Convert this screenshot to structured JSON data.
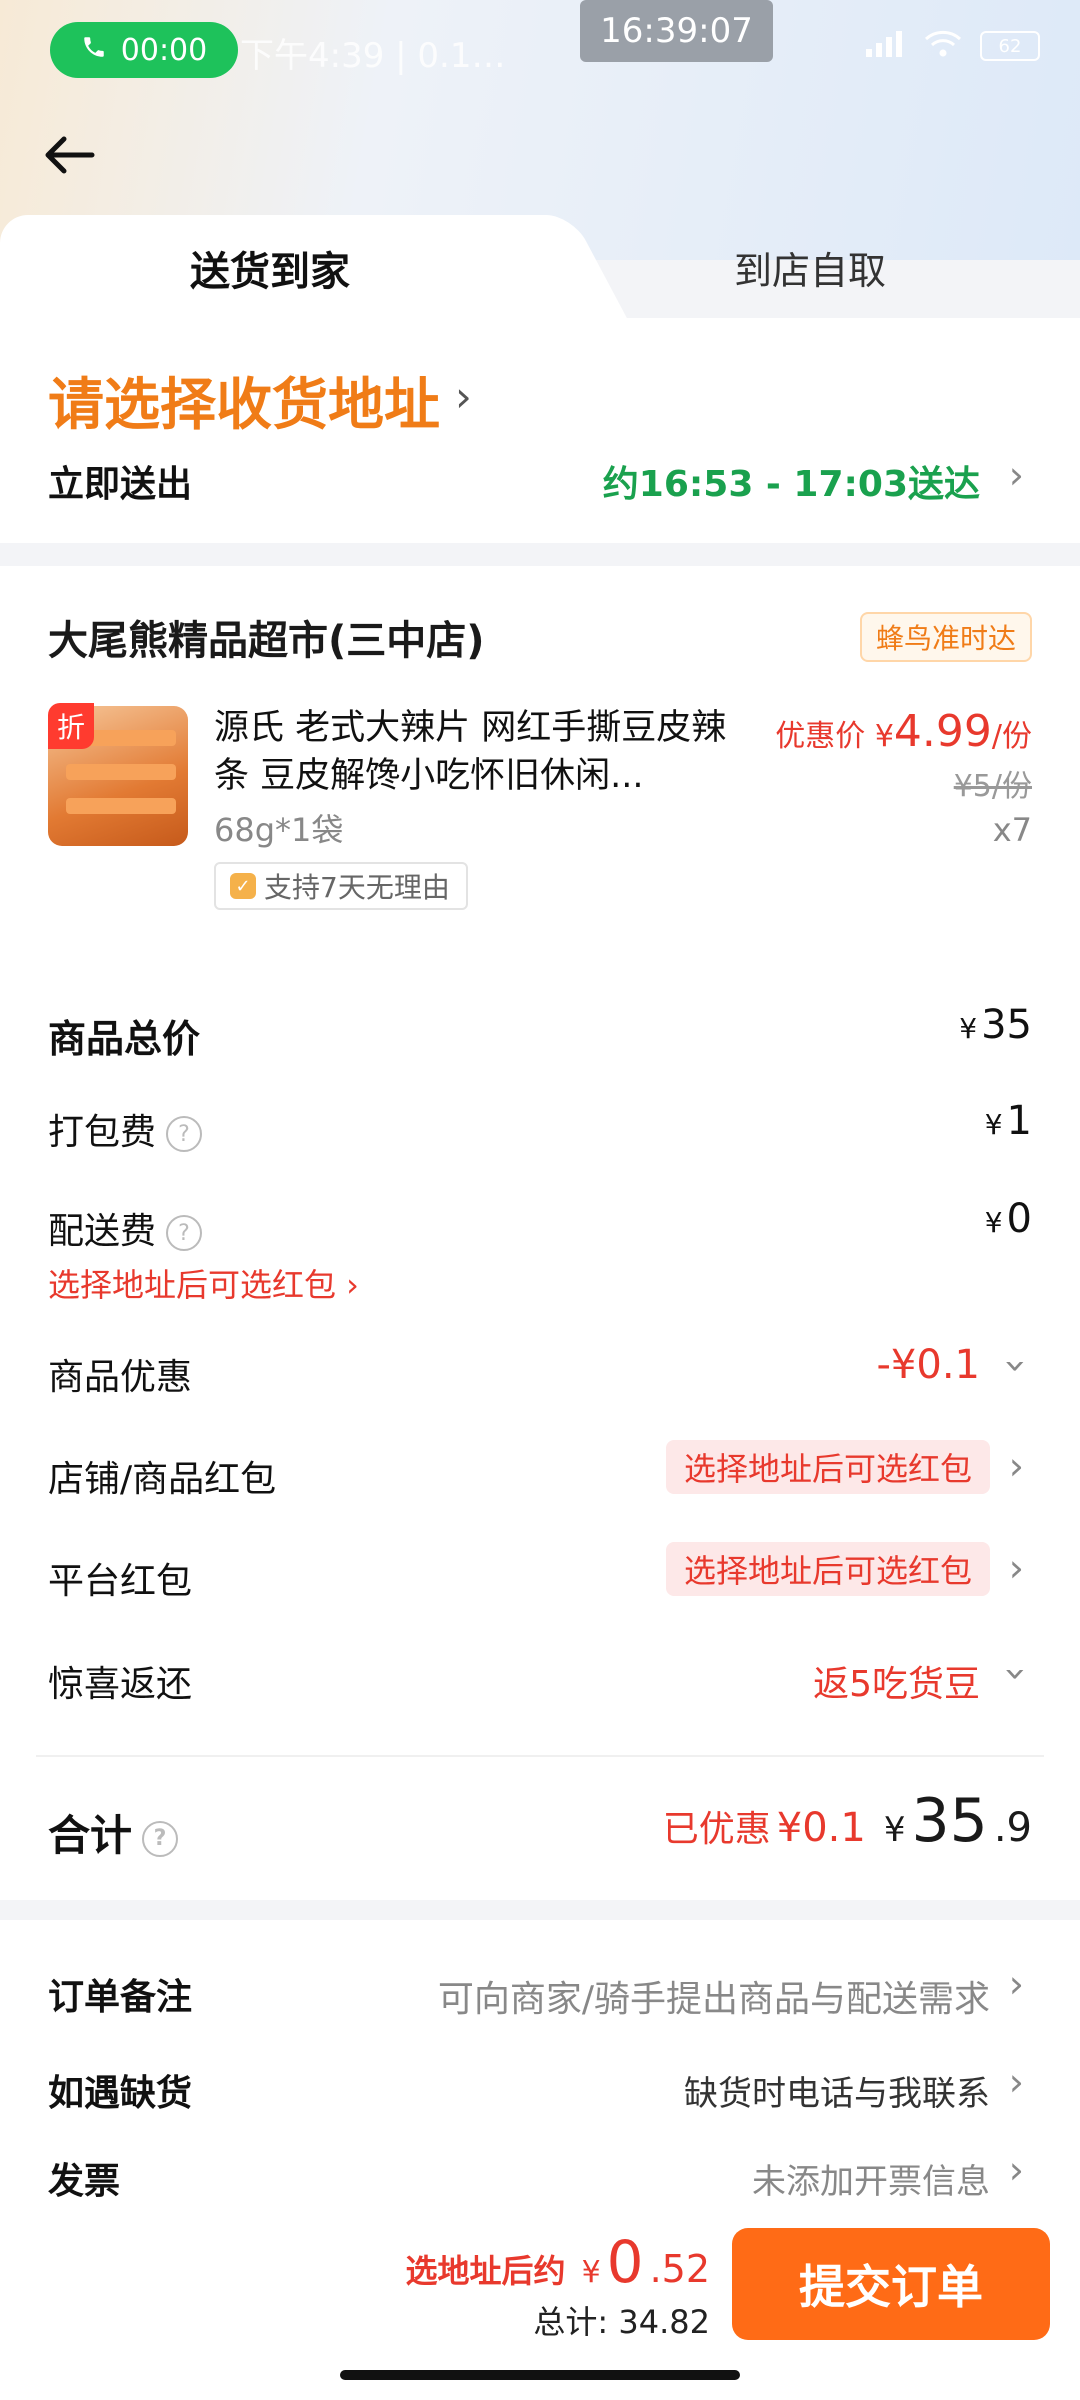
{
  "status_bar": {
    "call_time": "00:00",
    "left_text": "下午4:39 | 0.1…",
    "clock": "16:39:07",
    "battery": "62"
  },
  "tabs": [
    {
      "label": "送货到家",
      "active": true
    },
    {
      "label": "到店自取",
      "active": false
    }
  ],
  "address": {
    "title": "请选择收货地址",
    "dispatch_label": "立即送出",
    "eta": "约16:53 - 17:03送达"
  },
  "shop": {
    "name": "大尾熊精品超市(三中店)",
    "delivery_tag": "蜂鸟准时达"
  },
  "item": {
    "tag": "折",
    "title": "源氏 老式大辣片 网红手撕豆皮辣条 豆皮解馋小吃怀旧休闲...",
    "spec": "68g*1袋",
    "badge": "支持7天无理由",
    "price_label": "优惠价",
    "price_currency": "¥",
    "price": "4.99",
    "price_unit": "/份",
    "original_price": "¥5/份",
    "quantity": "x7"
  },
  "fees": {
    "goods_total_label": "商品总价",
    "goods_total": "35",
    "packing_label": "打包费",
    "packing": "1",
    "delivery_label": "配送费",
    "delivery": "0",
    "delivery_note": "选择地址后可选红包 ›",
    "discount_label": "商品优惠",
    "discount": "-¥0.1",
    "shop_redpacket_label": "店铺/商品红包",
    "shop_redpacket_tag": "选择地址后可选红包",
    "platform_redpacket_label": "平台红包",
    "platform_redpacket_tag": "选择地址后可选红包",
    "surprise_label": "惊喜返还",
    "surprise_value": "返5吃货豆"
  },
  "total": {
    "label": "合计",
    "saved_label": "已优惠",
    "saved": "¥0.1",
    "currency": "¥",
    "amount_int": "35",
    "amount_dec": ".9"
  },
  "extras": {
    "note_label": "订单备注",
    "note_value": "可向商家/骑手提出商品与配送需求",
    "stockout_label": "如遇缺货",
    "stockout_value": "缺货时电话与我联系",
    "invoice_label": "发票",
    "invoice_value": "未添加开票信息"
  },
  "bottom": {
    "after_addr_label": "选地址后约",
    "currency": "¥",
    "amount_big": "0",
    "amount_small": ".52",
    "total_label": "总计: 34.82",
    "submit": "提交订单"
  },
  "colors": {
    "accent_orange": "#ff6b16",
    "address_orange": "#f07c17",
    "eta_green": "#1aa14e",
    "price_red": "#e8392d"
  }
}
